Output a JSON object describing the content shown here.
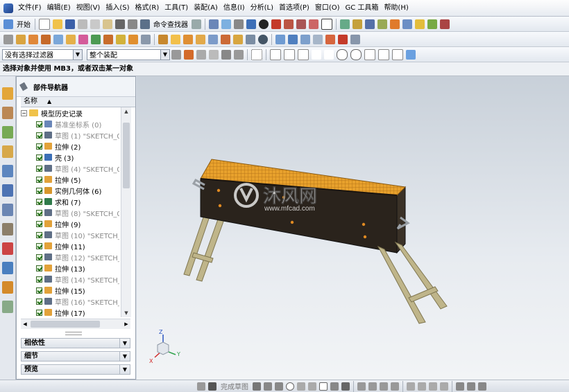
{
  "menu": [
    "文件(F)",
    "编辑(E)",
    "视图(V)",
    "插入(S)",
    "格式(R)",
    "工具(T)",
    "装配(A)",
    "信息(I)",
    "分析(L)",
    "首选项(P)",
    "窗口(O)",
    "GC 工具箱",
    "帮助(H)"
  ],
  "toolbar": {
    "start_label": "开始",
    "command_finder": "命令查找器",
    "filter_value": "没有选择过滤器",
    "assembly_value": "整个装配"
  },
  "status": {
    "prompt": "选择对象并使用 MB3，或者双击某一对象"
  },
  "navigator": {
    "title": "部件导航器",
    "column": "名称",
    "root": "模型历史记录",
    "items": [
      {
        "label": "基准坐标系 (0)",
        "kind": "datum",
        "dim": true
      },
      {
        "label": "草图 (1) \"SKETCH_0",
        "kind": "sketch",
        "dim": true
      },
      {
        "label": "拉伸 (2)",
        "kind": "extrude",
        "dim": false
      },
      {
        "label": "壳 (3)",
        "kind": "shell",
        "dim": false
      },
      {
        "label": "草图 (4) \"SKETCH_0",
        "kind": "sketch",
        "dim": true
      },
      {
        "label": "拉伸 (5)",
        "kind": "extrude",
        "dim": false
      },
      {
        "label": "实例几何体 (6)",
        "kind": "instance",
        "dim": false
      },
      {
        "label": "求和 (7)",
        "kind": "unite",
        "dim": false
      },
      {
        "label": "草图 (8) \"SKETCH_0",
        "kind": "sketch",
        "dim": true
      },
      {
        "label": "拉伸 (9)",
        "kind": "extrude",
        "dim": false
      },
      {
        "label": "草图 (10) \"SKETCH_",
        "kind": "sketch",
        "dim": true
      },
      {
        "label": "拉伸 (11)",
        "kind": "extrude",
        "dim": false
      },
      {
        "label": "草图 (12) \"SKETCH_",
        "kind": "sketch",
        "dim": true
      },
      {
        "label": "拉伸 (13)",
        "kind": "extrude",
        "dim": false
      },
      {
        "label": "草图 (14) \"SKETCH_",
        "kind": "sketch",
        "dim": true
      },
      {
        "label": "拉伸 (15)",
        "kind": "extrude",
        "dim": false
      },
      {
        "label": "草图 (16) \"SKETCH_",
        "kind": "sketch",
        "dim": true
      },
      {
        "label": "拉伸 (17)",
        "kind": "extrude",
        "dim": false
      }
    ],
    "panels": [
      "相依性",
      "细节",
      "预览"
    ]
  },
  "viewport": {
    "watermark_brand": "沐风网",
    "watermark_url": "www.mfcad.com",
    "triad": {
      "z": "Z",
      "y": "Y",
      "x": "X"
    }
  },
  "bottombar": {
    "finish_sketch": "完成草图"
  },
  "colors": {
    "grill_mesh": "#e8a12c",
    "grill_body": "#2a231c",
    "legs": "#bfb58a",
    "handle": "#9aa0a6"
  }
}
